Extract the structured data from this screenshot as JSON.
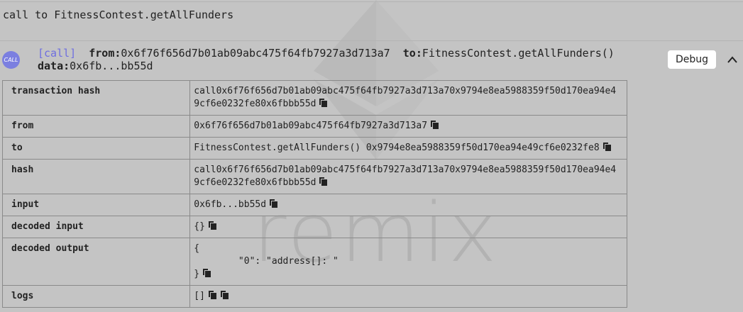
{
  "watermark": {
    "text": "remix"
  },
  "call_title": "call to FitnessContest.getAllFunders",
  "badge": {
    "label": "CALL"
  },
  "summary": {
    "tag": "[call]",
    "from_label": "from:",
    "from_value": "0x6f76f656d7b01ab09abc475f64fb7927a3d713a7",
    "to_label": "to:",
    "to_value": "FitnessContest.getAllFunders()",
    "data_label": "data:",
    "data_value": "0x6fb...bb55d"
  },
  "debug_button": {
    "label": "Debug"
  },
  "rows": {
    "transaction_hash": {
      "key": "transaction hash",
      "value": "call0x6f76f656d7b01ab09abc475f64fb7927a3d713a70x9794e8ea5988359f50d170ea94e49cf6e0232fe80x6fbbb55d"
    },
    "from": {
      "key": "from",
      "value": "0x6f76f656d7b01ab09abc475f64fb7927a3d713a7"
    },
    "to": {
      "key": "to",
      "value": "FitnessContest.getAllFunders() 0x9794e8ea5988359f50d170ea94e49cf6e0232fe8"
    },
    "hash": {
      "key": "hash",
      "value": "call0x6f76f656d7b01ab09abc475f64fb7927a3d713a70x9794e8ea5988359f50d170ea94e49cf6e0232fe80x6fbbb55d"
    },
    "input": {
      "key": "input",
      "value": "0x6fb...bb55d"
    },
    "decoded_input": {
      "key": "decoded input",
      "value": "{}"
    },
    "decoded_output": {
      "key": "decoded output",
      "open": "{",
      "line": "\t\"0\": \"address[]: \"",
      "close": "}"
    },
    "logs": {
      "key": "logs",
      "value": "[]"
    }
  },
  "icons": {
    "copy": "copy-icon",
    "collapse": "chevron-up-icon"
  },
  "colors": {
    "background": "#c4c4c4",
    "accent": "#6e6ee0",
    "badge": "#7b7fe0"
  }
}
